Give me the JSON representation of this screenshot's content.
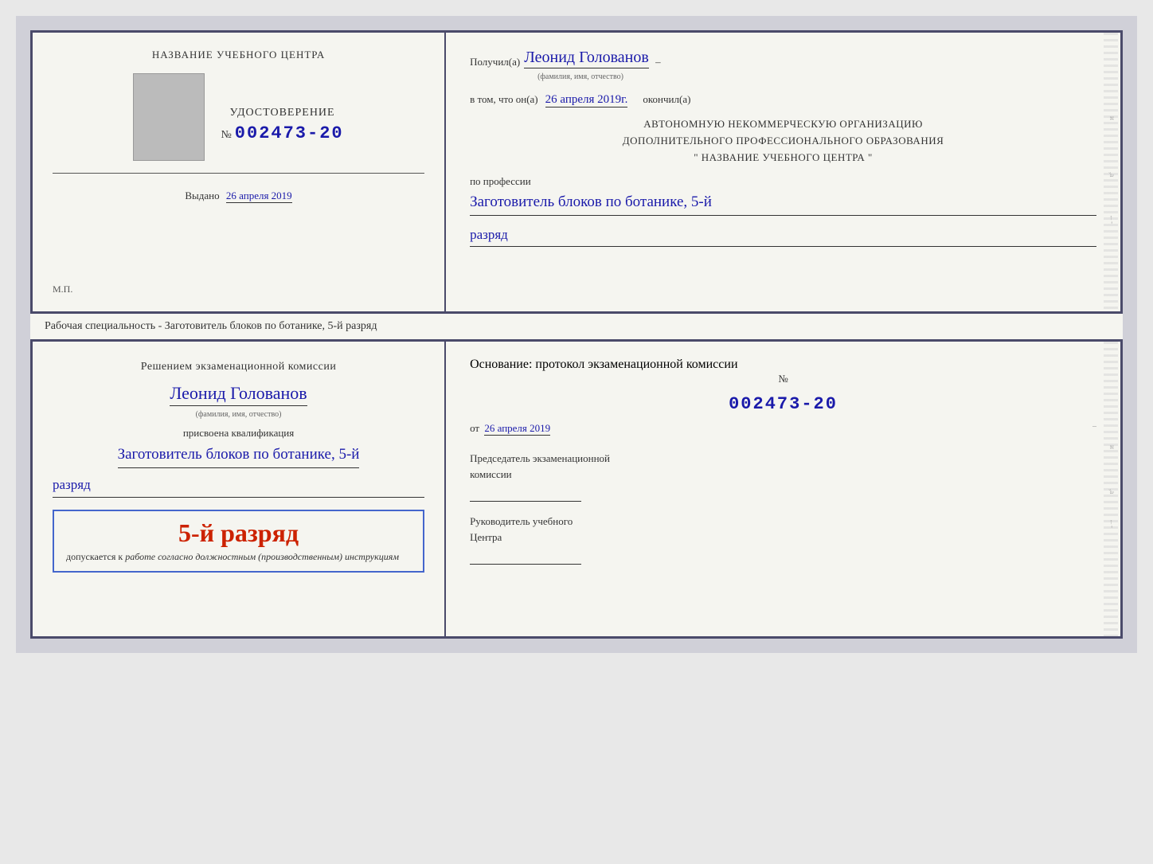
{
  "page": {
    "background_color": "#d0d8e0"
  },
  "top_document": {
    "left": {
      "title": "НАЗВАНИЕ УЧЕБНОГО ЦЕНТРА",
      "cert_label": "УДОСТОВЕРЕНИЕ",
      "cert_number_prefix": "№",
      "cert_number": "002473-20",
      "issued_label": "Выдано",
      "issued_date": "26 апреля 2019",
      "mp_label": "М.П."
    },
    "right": {
      "received_label": "Получил(а)",
      "recipient_name": "Леонид Голованов",
      "fio_sublabel": "(фамилия, имя, отчество)",
      "in_that_label": "в том, что он(а)",
      "date_value": "26 апреля 2019г.",
      "finished_label": "окончил(а)",
      "org_line1": "АВТОНОМНУЮ НЕКОММЕРЧЕСКУЮ ОРГАНИЗАЦИЮ",
      "org_line2": "ДОПОЛНИТЕЛЬНОГО ПРОФЕССИОНАЛЬНОГО ОБРАЗОВАНИЯ",
      "org_line3": "\"  НАЗВАНИЕ УЧЕБНОГО ЦЕНТРА  \"",
      "profession_label": "по профессии",
      "profession_value": "Заготовитель блоков по ботанике, 5-й",
      "rank_value": "разряд"
    }
  },
  "annotation": {
    "text": "Рабочая специальность - Заготовитель блоков по ботанике, 5-й разряд"
  },
  "bottom_document": {
    "left": {
      "decision_line1": "Решением экзаменационной комиссии",
      "person_name": "Леонид Голованов",
      "fio_sublabel": "(фамилия, имя, отчество)",
      "assigned_label": "присвоена квалификация",
      "qualification_value": "Заготовитель блоков по ботанике, 5-й",
      "rank_value": "разряд",
      "badge_title": "5-й разряд",
      "badge_prefix": "допускается к",
      "badge_suffix_italic": "работе согласно должностным (производственным) инструкциям"
    },
    "right": {
      "basis_label": "Основание: протокол экзаменационной комиссии",
      "protocol_number_prefix": "№",
      "protocol_number": "002473-20",
      "from_label": "от",
      "from_date": "26 апреля 2019",
      "chairman_line1": "Председатель экзаменационной",
      "chairman_line2": "комиссии",
      "head_line1": "Руководитель учебного",
      "head_line2": "Центра"
    }
  }
}
